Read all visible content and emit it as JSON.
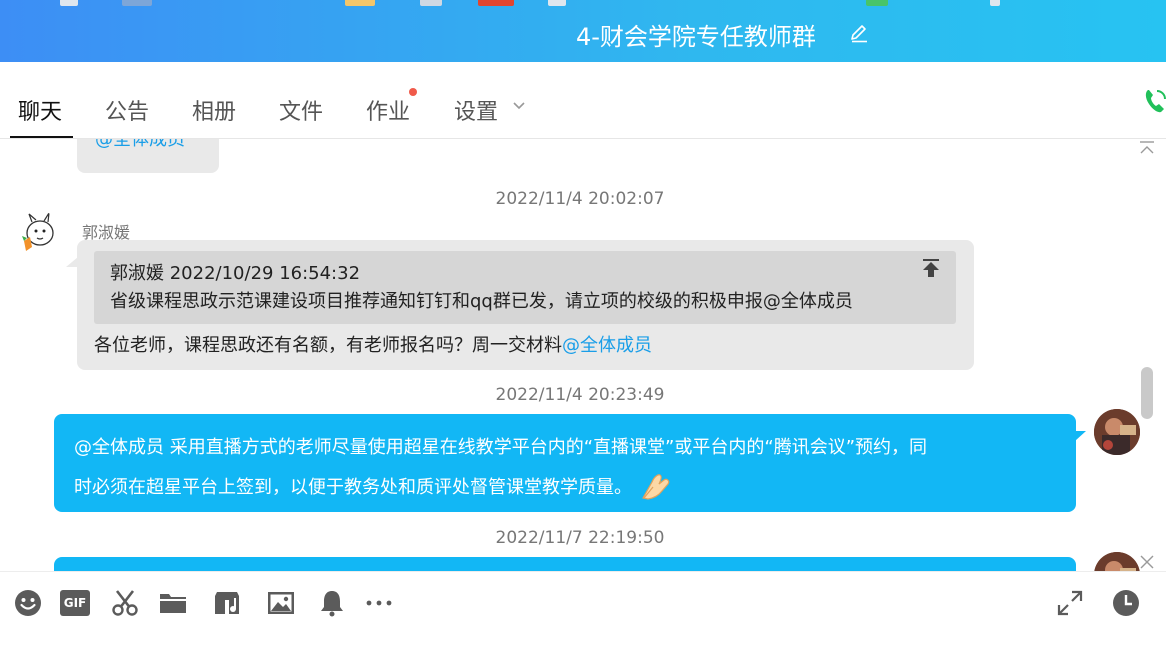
{
  "window": {
    "title": "4-财会学院专任教师群"
  },
  "tabs": [
    {
      "label": "聊天",
      "active": true
    },
    {
      "label": "公告"
    },
    {
      "label": "相册"
    },
    {
      "label": "文件"
    },
    {
      "label": "作业",
      "has_notification": true
    },
    {
      "label": "设置"
    }
  ],
  "chat": {
    "partial_top_message": "@全体成员",
    "messages": [
      {
        "timestamp": "2022/11/4 20:02:07",
        "sender": "郭淑媛",
        "quote": {
          "header": "郭淑媛  2022/10/29 16:54:32",
          "body": "省级课程思政示范课建设项目推荐通知钉钉和qq群已发，请立项的校级的积极申报@全体成员"
        },
        "text": "各位老师，课程思政还有名额，有老师报名吗？周一交材料",
        "mention": "@全体成员"
      },
      {
        "timestamp": "2022/11/4 20:23:49",
        "line1": "@全体成员 采用直播方式的老师尽量使用超星在线教学平台内的“直播课堂”或平台内的“腾讯会议”预约，同",
        "line2": "时必须在超星平台上签到，以便于教务处和质评处督管课堂教学质量。",
        "emoji": "🙏"
      },
      {
        "timestamp": "2022/11/7 22:19:50"
      }
    ]
  },
  "toolbar": {
    "icons": [
      "emoji-icon",
      "gif-icon",
      "scissors-icon",
      "folder-icon",
      "music-icon",
      "image-icon",
      "bell-icon",
      "more-icon",
      "expand-icon",
      "history-icon"
    ],
    "gif_label": "GIF"
  },
  "colors": {
    "title_gradient_start": "#3d8ef5",
    "title_gradient_end": "#27c3f2",
    "self_bubble": "#12b7f5",
    "other_bubble": "#e9e9e9",
    "mention": "#1a9ee8"
  }
}
